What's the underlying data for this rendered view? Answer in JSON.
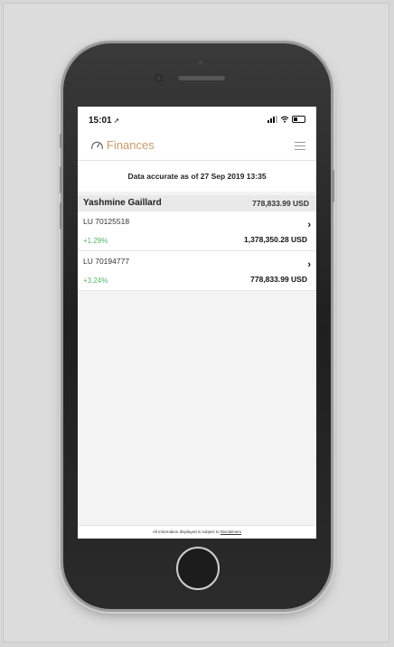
{
  "status_bar": {
    "time": "15:01"
  },
  "header": {
    "title": "Finances",
    "logo_icon": "gauge-icon",
    "menu_icon": "hamburger-menu-icon"
  },
  "accuracy": {
    "text": "Data accurate as of 27 Sep 2019 13:35"
  },
  "group": {
    "name": "Yashmine Gaillard",
    "total": "778,833.99 USD"
  },
  "accounts": [
    {
      "id": "LU 70125518",
      "change": "+1.29%",
      "value": "1,378,350.28 USD"
    },
    {
      "id": "LU 70194777",
      "change": "+3.24%",
      "value": "778,833.99 USD"
    }
  ],
  "footer": {
    "text": "All information displayed is subject to",
    "link": "Disclaimers"
  },
  "colors": {
    "brand": "#c79a6c",
    "positive": "#53b766"
  }
}
